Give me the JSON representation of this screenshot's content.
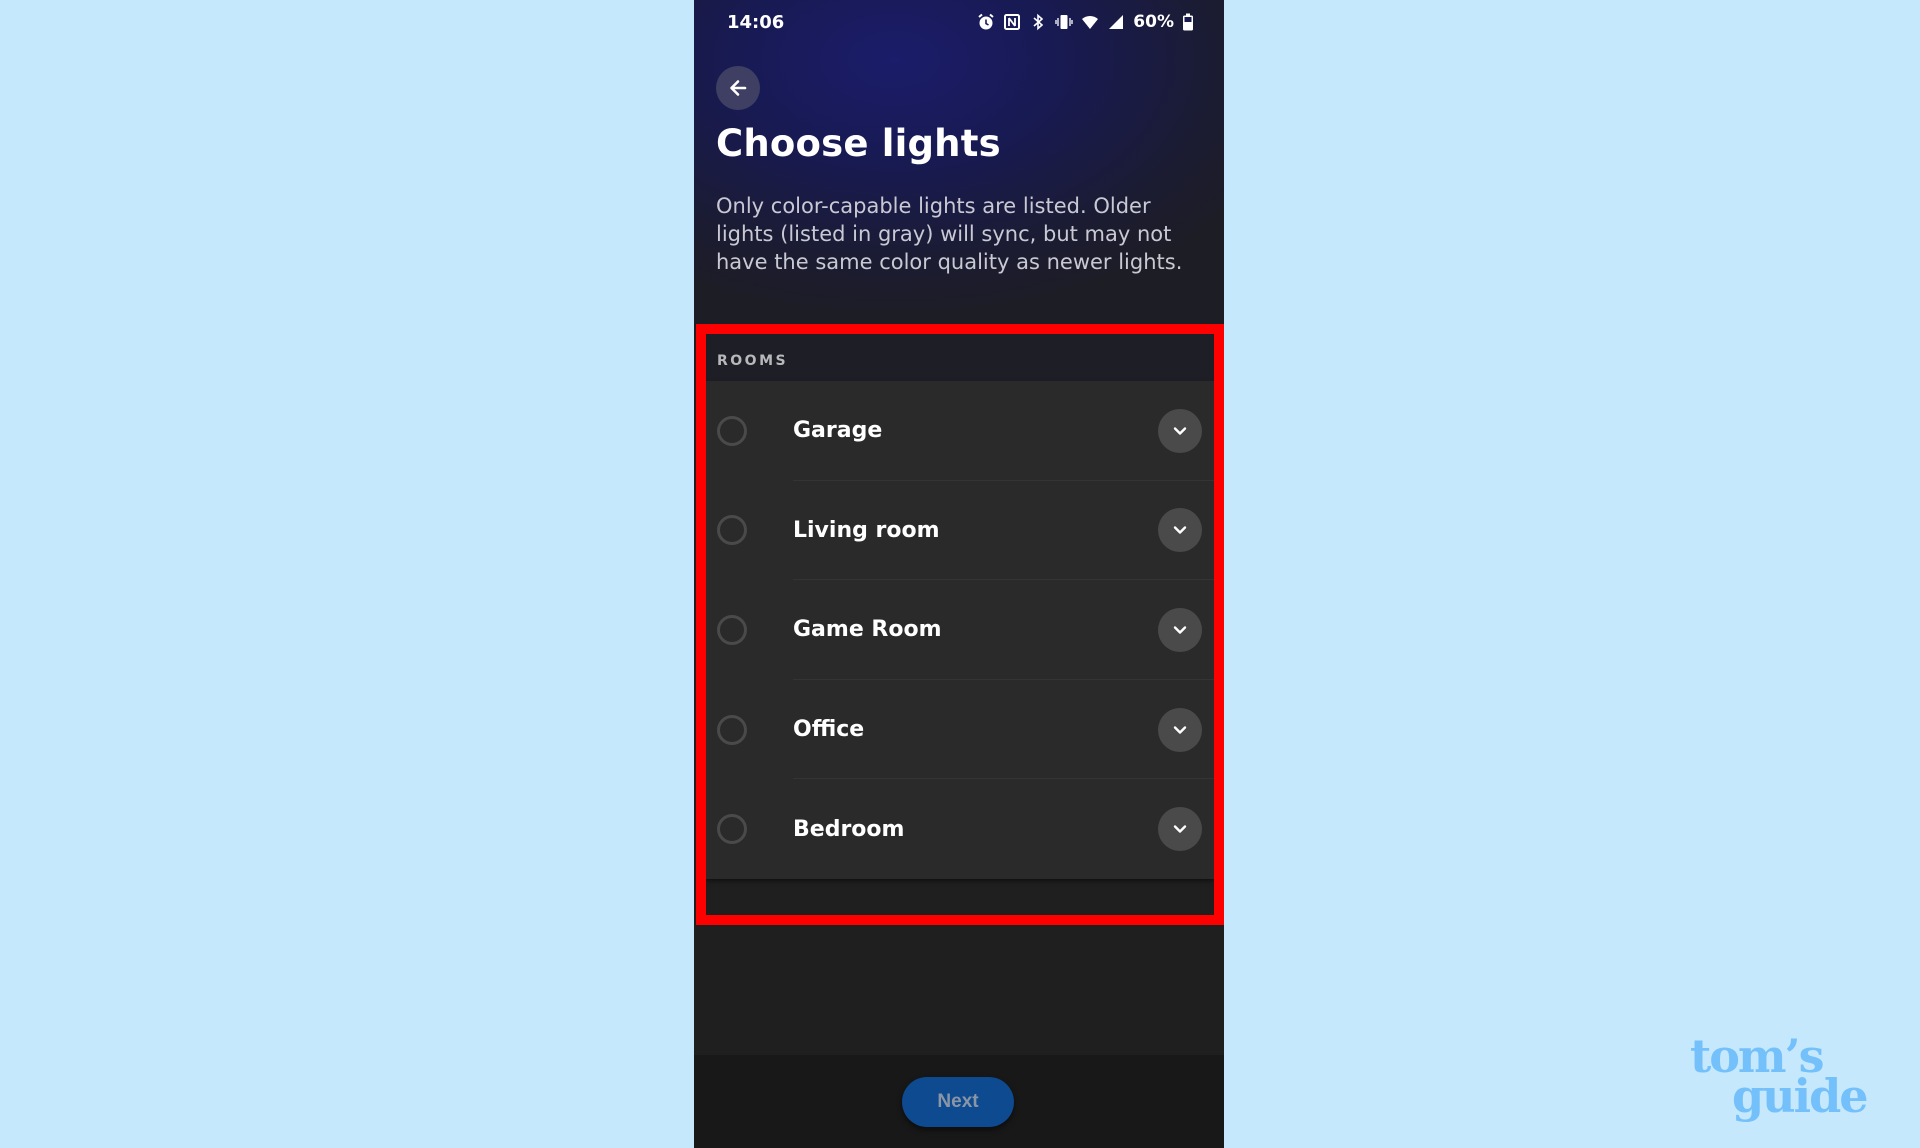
{
  "status_bar": {
    "time": "14:06",
    "battery": "60%",
    "icons": [
      "alarm-icon",
      "nfc-icon",
      "bluetooth-icon",
      "vibrate-icon",
      "wifi-icon",
      "signal-icon",
      "battery-icon"
    ]
  },
  "header": {
    "back_icon": "arrow-left-icon",
    "title": "Choose lights",
    "description": "Only color-capable lights are listed. Older lights (listed in gray) will sync, but may not have the same color quality as newer lights."
  },
  "rooms": {
    "section_label": "ROOMS",
    "items": [
      {
        "label": "Garage",
        "selected": false
      },
      {
        "label": "Living room",
        "selected": false
      },
      {
        "label": "Game Room",
        "selected": false
      },
      {
        "label": "Office",
        "selected": false
      },
      {
        "label": "Bedroom",
        "selected": false
      }
    ]
  },
  "footer": {
    "next_label": "Next"
  },
  "watermark": {
    "line1": "tom’s",
    "line2": "guide"
  },
  "colors": {
    "highlight_box": "#ff0000",
    "next_button": "#0d4a8f",
    "page_background": "#c5e8fc"
  }
}
